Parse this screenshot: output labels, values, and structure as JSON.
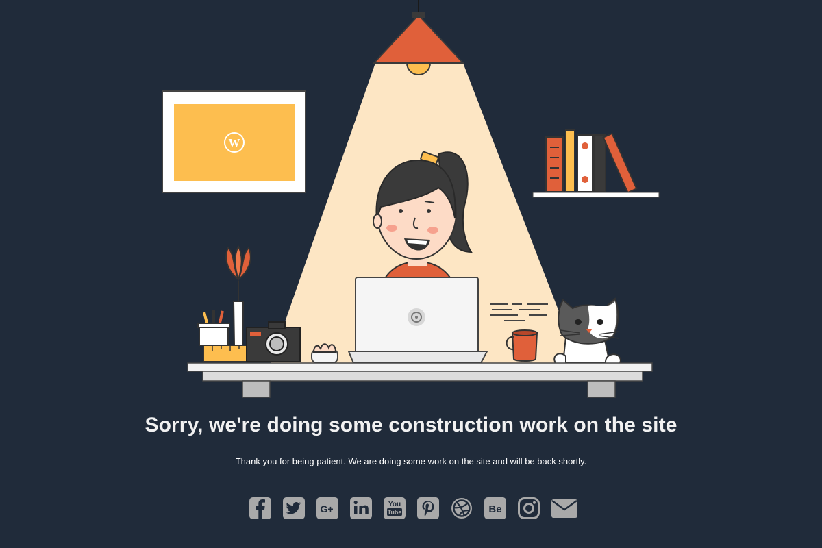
{
  "message": {
    "headline": "Sorry, we're doing some construction work on the site",
    "subtext": "Thank you for being patient. We are doing some work on the site and will be back shortly."
  },
  "colors": {
    "background": "#202b3a",
    "lamp": "#e0603a",
    "light_beam": "#fde6c4",
    "frame_fill": "#fdbe4f",
    "icon_gray": "#a9a9a9"
  },
  "illustration": {
    "frame_icon": "wordpress-icon",
    "laptop_icon": "gear-icon"
  },
  "social": [
    {
      "name": "facebook-icon",
      "glyph": "f"
    },
    {
      "name": "twitter-icon",
      "glyph": "bird"
    },
    {
      "name": "google-plus-icon",
      "glyph": "G+"
    },
    {
      "name": "linkedin-icon",
      "glyph": "in"
    },
    {
      "name": "youtube-icon",
      "glyph": "You Tube"
    },
    {
      "name": "pinterest-icon",
      "glyph": "P"
    },
    {
      "name": "dribbble-icon",
      "glyph": "ball"
    },
    {
      "name": "behance-icon",
      "glyph": "Be"
    },
    {
      "name": "instagram-icon",
      "glyph": "camera"
    },
    {
      "name": "email-icon",
      "glyph": "envelope"
    }
  ]
}
